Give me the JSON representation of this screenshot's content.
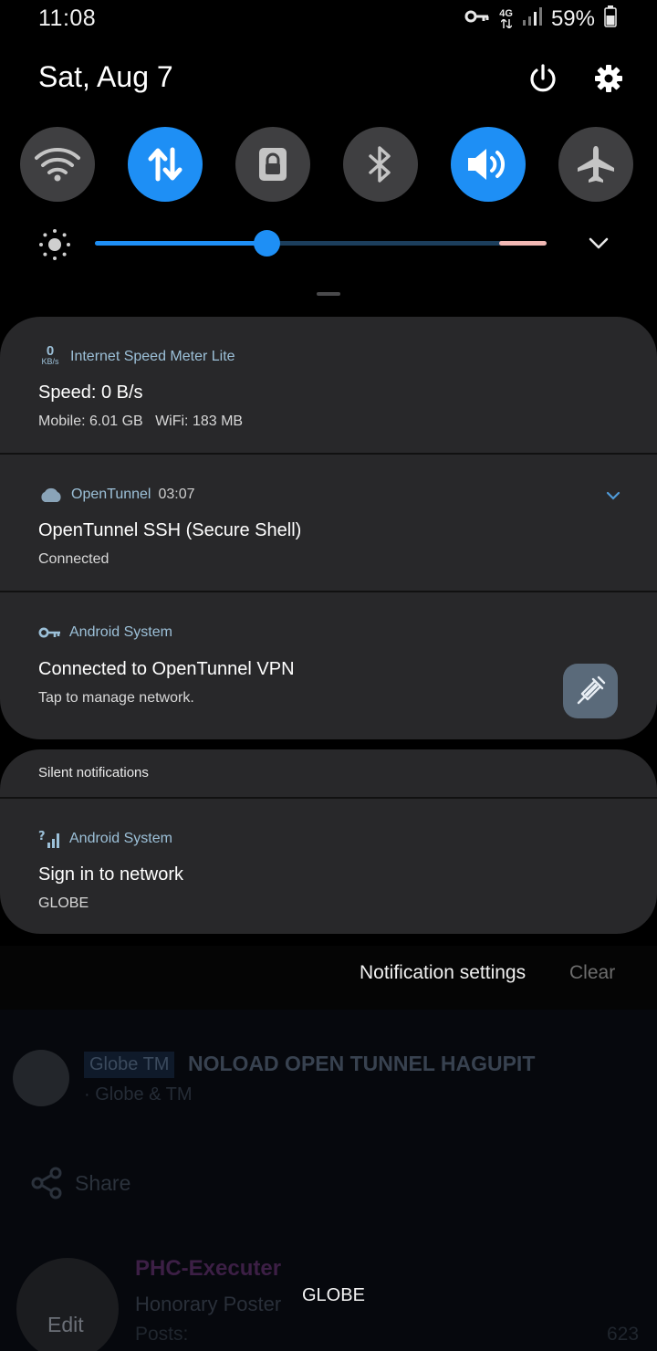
{
  "status_bar": {
    "time": "11:08",
    "network_type": "4G",
    "battery": "59%"
  },
  "header": {
    "date": "Sat, Aug 7",
    "power_icon": "power-icon",
    "settings_icon": "gear-icon"
  },
  "quick_tiles": [
    {
      "name": "Wi-Fi",
      "icon": "wifi-icon",
      "active": false
    },
    {
      "name": "Mobile data",
      "icon": "data-transfer-icon",
      "active": true
    },
    {
      "name": "Screen lock",
      "icon": "lock-icon",
      "active": false
    },
    {
      "name": "Bluetooth",
      "icon": "bluetooth-icon",
      "active": false
    },
    {
      "name": "Sound",
      "icon": "volume-icon",
      "active": true
    },
    {
      "name": "Airplane mode",
      "icon": "airplane-icon",
      "active": false
    }
  ],
  "brightness": {
    "level": 0.38
  },
  "colors": {
    "accent": "#1e8ff5",
    "card": "#28282a",
    "app_label": "#9cc0d8"
  },
  "notifications": [
    {
      "app_badge_value": "0",
      "app_badge_unit": "KB/s",
      "app": "Internet Speed Meter Lite",
      "title": "Speed: 0 B/s",
      "text": "Mobile: 6.01 GB   WiFi: 183 MB"
    },
    {
      "app": "OpenTunnel",
      "time": "03:07",
      "title": "OpenTunnel SSH (Secure Shell)",
      "text": "Connected"
    },
    {
      "app": "Android System",
      "title": "Connected to OpenTunnel VPN",
      "text": "Tap to manage network."
    }
  ],
  "silent": {
    "header": "Silent notifications",
    "items": [
      {
        "app": "Android System",
        "title": "Sign in to network",
        "text": "GLOBE"
      }
    ]
  },
  "footer": {
    "settings_label": "Notification settings",
    "clear_label": "Clear"
  },
  "background_app": {
    "tag": "Globe TM",
    "title": "NOLOAD OPEN TUNNEL HAGUPIT",
    "subtitle": "· Globe & TM",
    "share_label": "Share",
    "username": "PHC-Executer",
    "rank": "Honorary Poster",
    "posts_label": "Posts:",
    "posts_count": "623",
    "edit_label": "Edit",
    "overlay_text": "GLOBE"
  }
}
